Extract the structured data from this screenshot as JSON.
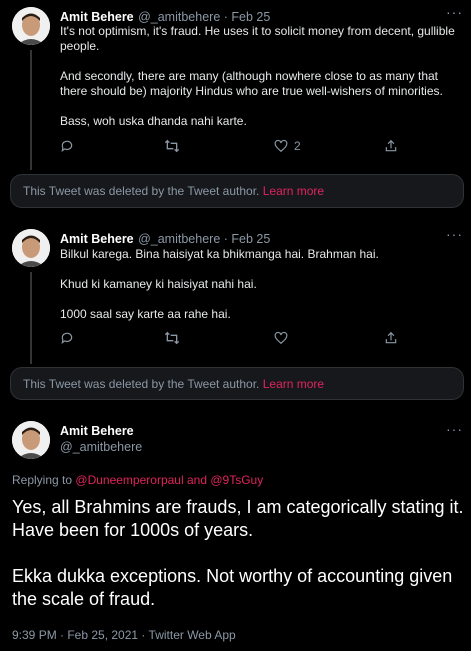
{
  "tweet1": {
    "name": "Amit Behere",
    "handle_time": "@_amitbehere · Feb 25",
    "line1": "It's not optimism, it's fraud. He uses it to solicit money from decent, gullible",
    "line2": "people.",
    "line3": "And secondly, there are many (although nowhere close to as many that",
    "line4": "there should be) majority Hindus who are true well-wishers of minorities.",
    "line5": "Bass, woh uska dhanda nahi karte.",
    "likes": "2"
  },
  "deleted1": {
    "text": "This Tweet was deleted by the Tweet author.",
    "link": "Learn more"
  },
  "tweet2": {
    "name": "Amit Behere",
    "handle_time": "@_amitbehere · Feb 25",
    "line1": "Bilkul karega. Bina haisiyat ka bhikmanga hai. Brahman hai.",
    "line2": "Khud ki kamaney ki haisiyat nahi hai.",
    "line3": "1000 saal say karte aa rahe hai."
  },
  "deleted2": {
    "text": "This Tweet was deleted by the Tweet author.",
    "link": "Learn more"
  },
  "main": {
    "name": "Amit Behere",
    "handle": "@_amitbehere",
    "replying_prefix": "Replying to",
    "mention1": "@Duneemperorpaul",
    "and": "and",
    "mention2": "@9TsGuy",
    "line1": "Yes, all Brahmins are frauds, I am categorically stating it.",
    "line2": "Have been for 1000s of years.",
    "line3": "Ekka dukka exceptions. Not worthy of accounting given",
    "line4": "the scale of fraud.",
    "meta": "9:39 PM · Feb 25, 2021 · Twitter Web App"
  },
  "more_glyph": "···",
  "colors": {
    "accent": "#e0245e",
    "muted": "#8b98a5",
    "background": "#000000"
  },
  "icons": [
    "avatar",
    "reply-icon",
    "retweet-icon",
    "like-icon",
    "share-icon",
    "more-icon"
  ]
}
